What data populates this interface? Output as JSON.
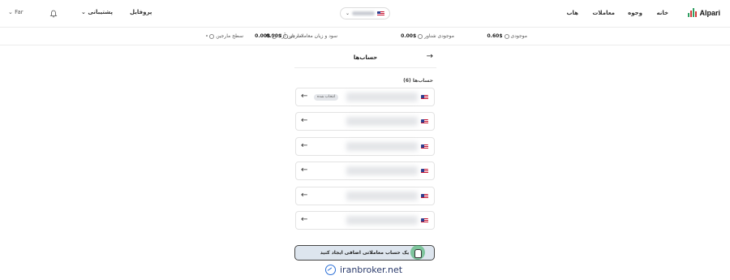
{
  "brand": {
    "logo_text": "Alpari"
  },
  "nav": {
    "home": "خانه",
    "funds": "وجوه",
    "trades": "معاملات",
    "hub": "هاب"
  },
  "header_right": {
    "profile": "پروفایل",
    "support": "پشتیبانی",
    "language": "Far"
  },
  "stats": [
    {
      "label": "موجودی",
      "value": "$0.60"
    },
    {
      "label": "موجودی شناور",
      "value": "$0.00"
    },
    {
      "label": "سود و زیان معاملات باز",
      "value": "$0.00"
    },
    {
      "label": "مارجین آزاد",
      "value": "$0.00"
    },
    {
      "label": "سطح مارجین",
      "value": "-"
    }
  ],
  "panel": {
    "title": "حساب‌ها",
    "list_title": "حساب‌ها (6)",
    "accounts": [
      {
        "badge": "انتخاب شده"
      },
      {
        "badge": ""
      },
      {
        "badge": ""
      },
      {
        "badge": ""
      },
      {
        "badge": ""
      },
      {
        "badge": ""
      }
    ],
    "create_button": "یک حساب معاملاتی اضافی ایجاد کنید"
  },
  "watermark": "iranbroker.net",
  "colors": {
    "accent_green": "#2eaa5a",
    "logo_red": "#d23b3b",
    "watermark_blue": "#2b6fd6"
  }
}
